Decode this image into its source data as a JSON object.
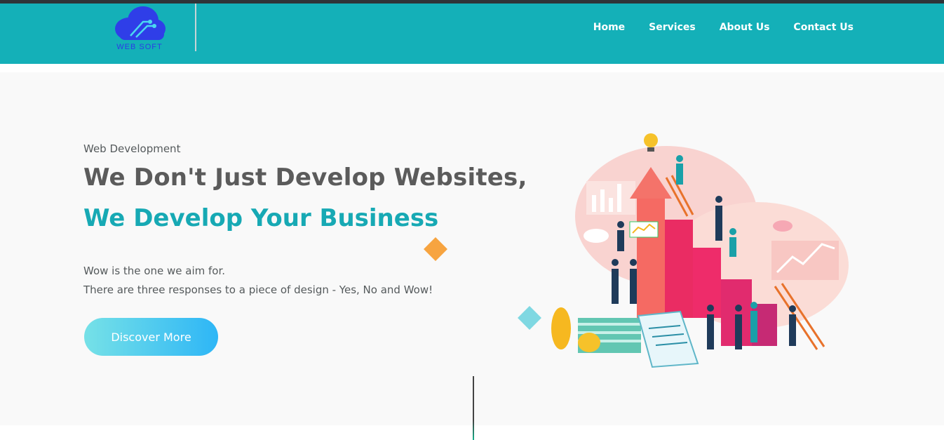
{
  "brand": {
    "logo_text": "WEB SOFT"
  },
  "nav": {
    "items": [
      {
        "label": "Home"
      },
      {
        "label": "Services"
      },
      {
        "label": "About Us"
      },
      {
        "label": "Contact Us"
      }
    ]
  },
  "hero": {
    "eyebrow": "Web Development",
    "headline_line1": "We Don't Just Develop Websites,",
    "headline_line2": "We Develop Your Business",
    "paragraph_line1": "Wow is the one we aim for.",
    "paragraph_line2": "There are three responses to a piece of design - Yes, No and Wow!",
    "cta_label": "Discover More"
  },
  "colors": {
    "header_bg": "#14b0b8",
    "accent_teal": "#17a9b4",
    "diamond_orange": "#f7a440",
    "diamond_cyan": "#7fd8e2"
  },
  "icons": [
    "cloud-logo-icon"
  ]
}
